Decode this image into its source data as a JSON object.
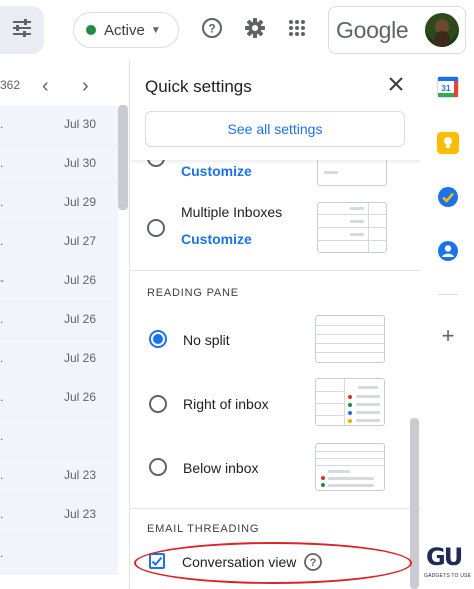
{
  "header": {
    "status": {
      "label": "Active",
      "color": "#1e8e3e"
    },
    "icons": [
      "filter-icon",
      "status-caret-icon",
      "help-icon",
      "settings-gear-icon",
      "apps-grid-icon"
    ],
    "brand": "Google"
  },
  "mail_list": {
    "count_fragment": "362",
    "rows": [
      {
        "snippet": ".",
        "date": "Jul 30"
      },
      {
        "snippet": ".",
        "date": "Jul 30"
      },
      {
        "snippet": ".",
        "date": "Jul 29"
      },
      {
        "snippet": ".",
        "date": "Jul 27"
      },
      {
        "snippet": "-",
        "date": "Jul 26"
      },
      {
        "snippet": ".",
        "date": "Jul 26"
      },
      {
        "snippet": ".",
        "date": "Jul 26"
      },
      {
        "snippet": ".",
        "date": "Jul 26"
      },
      {
        "snippet": ".",
        "date": ""
      },
      {
        "snippet": ".",
        "date": "Jul 23"
      },
      {
        "snippet": ".",
        "date": "Jul 23"
      },
      {
        "snippet": ".",
        "date": ""
      }
    ]
  },
  "quick_settings": {
    "title": "Quick settings",
    "see_all_label": "See all settings",
    "inbox_options": [
      {
        "label": "",
        "customize": "Customize",
        "selected": false
      },
      {
        "label": "Multiple Inboxes",
        "customize": "Customize",
        "selected": false
      }
    ],
    "reading_pane": {
      "heading": "READING PANE",
      "options": [
        {
          "label": "No split",
          "selected": true
        },
        {
          "label": "Right of inbox",
          "selected": false
        },
        {
          "label": "Below inbox",
          "selected": false
        }
      ]
    },
    "email_threading": {
      "heading": "EMAIL THREADING",
      "conversation_view_label": "Conversation view",
      "conversation_view_checked": true
    }
  },
  "side_panel": {
    "apps": [
      "calendar-icon",
      "keep-icon",
      "tasks-icon",
      "contacts-icon",
      "add-icon"
    ]
  },
  "watermark": {
    "logo": "GU",
    "text": "GADGETS TO USE"
  },
  "colors": {
    "accent": "#1a73e8",
    "annotation": "#d9242a",
    "active": "#1e8e3e"
  }
}
